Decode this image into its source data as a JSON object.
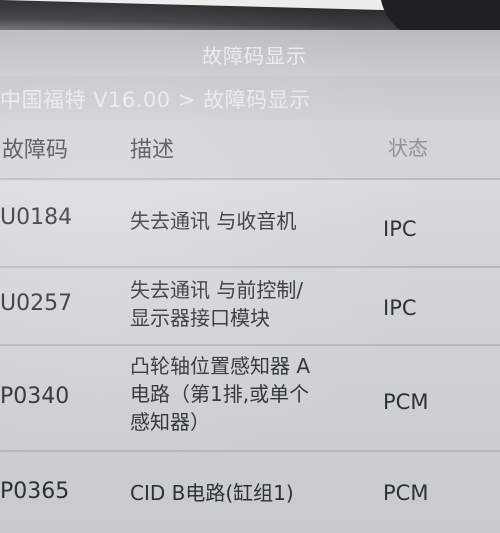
{
  "title": "故障码显示",
  "breadcrumb": "中国福特 V16.00 > 故障码显示",
  "table": {
    "headers": {
      "code": "故障码",
      "description": "描述",
      "status": "状态"
    },
    "rows": [
      {
        "code": "U0184",
        "desc_lines": [
          "失去通讯 与收音机"
        ],
        "status": "IPC"
      },
      {
        "code": "U0257",
        "desc_lines": [
          "失去通讯 与前控制/",
          "显示器接口模块"
        ],
        "status": "IPC"
      },
      {
        "code": "P0340",
        "desc_lines": [
          "凸轮轴位置感知器 A",
          "电路（第1排,或单个",
          "感知器）"
        ],
        "status": "PCM"
      },
      {
        "code": "P0365",
        "desc_lines": [
          "CID B电路(缸组1)"
        ],
        "status": "PCM"
      }
    ]
  }
}
